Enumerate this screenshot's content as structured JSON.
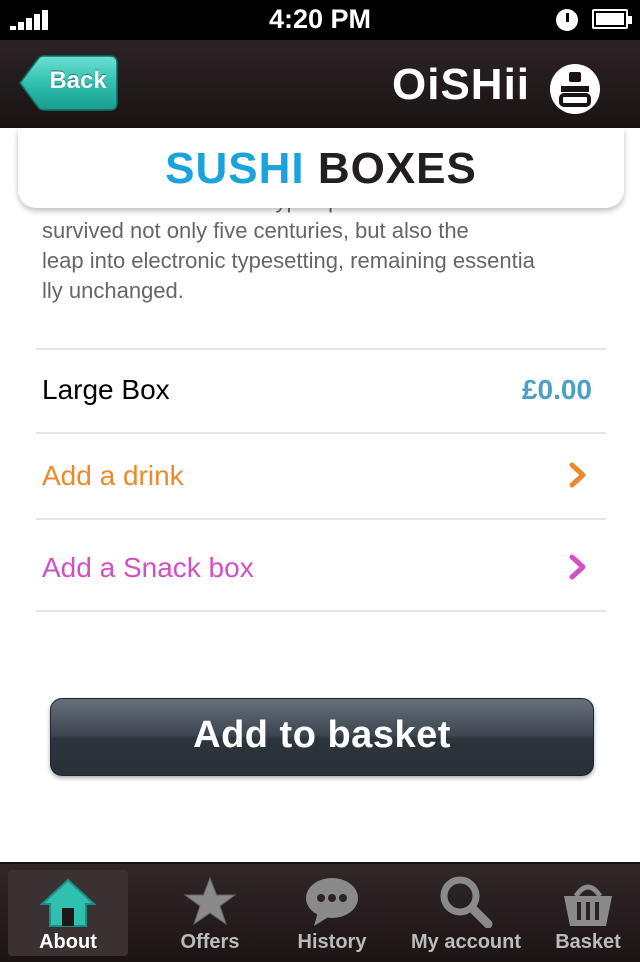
{
  "status_bar": {
    "time": "4:20 PM"
  },
  "nav": {
    "back_label": "Back",
    "logo_text": "OiSHii"
  },
  "header": {
    "title_part1": "SUSHI",
    "title_part2": "BOXES"
  },
  "description": {
    "text": "scrambled it to make a type specimen book. It has\nsurvived not only five centuries, but also the\nleap into electronic typesetting, remaining essentia\nlly unchanged."
  },
  "rows": [
    {
      "label": "Large Box",
      "price": "£0.00",
      "color": "#000000"
    },
    {
      "label": "Add a drink",
      "color": "#ea8a2b"
    },
    {
      "label": "Add a Snack box",
      "color": "#d24fc4"
    }
  ],
  "action": {
    "add_to_basket": "Add to basket"
  },
  "tabs": [
    {
      "label": "About",
      "icon": "home-icon",
      "active": true
    },
    {
      "label": "Offers",
      "icon": "star-icon"
    },
    {
      "label": "History",
      "icon": "speech-bubble-icon"
    },
    {
      "label": "My account",
      "icon": "search-icon"
    },
    {
      "label": "Basket",
      "icon": "basket-icon"
    }
  ],
  "colors": {
    "accent_teal": "#2fc0b0",
    "title_blue": "#1aa3dd",
    "price_blue": "#4aa0c6"
  }
}
